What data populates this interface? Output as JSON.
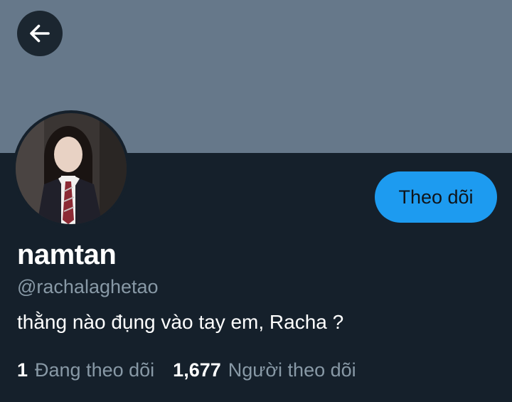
{
  "header": {
    "back_icon": "arrow-left-icon",
    "banner_color": "#66788a"
  },
  "profile": {
    "display_name": "namtan",
    "handle": "@rachalaghetao",
    "bio": "thằng nào đụng vào tay em, Racha ?",
    "follow_label": "Theo dõi",
    "following_count": "1",
    "following_label": "Đang theo dõi",
    "followers_count": "1,677",
    "followers_label": "Người theo dõi"
  },
  "colors": {
    "background": "#15202b",
    "accent": "#1d9bf0",
    "secondary_text": "#8899a6"
  }
}
